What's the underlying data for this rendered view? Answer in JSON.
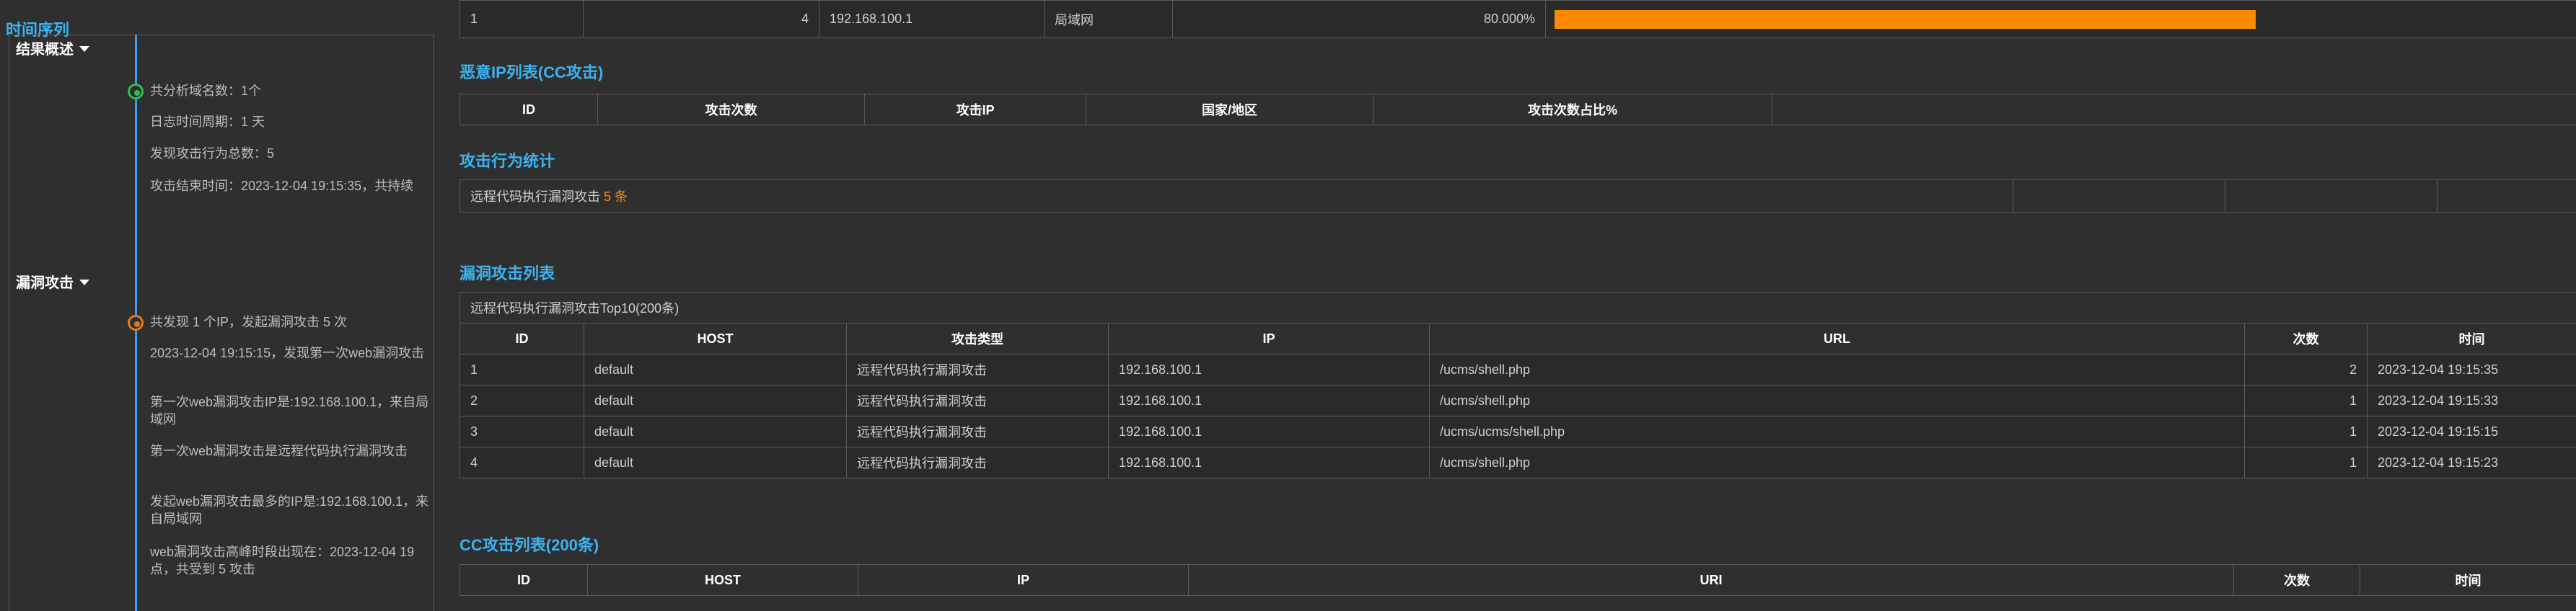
{
  "sidebar": {
    "title": "时间序列",
    "sections": [
      {
        "heading": "结果概述",
        "events": [
          "共分析域名数：1个",
          "日志时间周期：1 天",
          "发现攻击行为总数：5",
          "攻击结束时间：2023-12-04 19:15:35，共持续"
        ]
      },
      {
        "heading": "漏洞攻击",
        "events": [
          "共发现 1 个IP，发起漏洞攻击 5 次",
          "2023-12-04 19:15:15，发现第一次web漏洞攻击",
          "第一次web漏洞攻击IP是:192.168.100.1，来自局域网",
          "第一次web漏洞攻击是远程代码执行漏洞攻击",
          "发起web漏洞攻击最多的IP是:192.168.100.1，来自局域网",
          "web漏洞攻击高峰时段出现在：2023-12-04 19点，共受到 5 攻击"
        ]
      }
    ]
  },
  "top_row": {
    "id": "1",
    "count": "4",
    "ip": "192.168.100.1",
    "region": "局域网",
    "percent": "80.000%",
    "percent_value": 80
  },
  "cc_ip_list": {
    "title": "恶意IP列表(CC攻击)",
    "columns": [
      "ID",
      "攻击次数",
      "攻击IP",
      "国家/地区",
      "攻击次数占比%",
      ""
    ]
  },
  "attack_stats": {
    "title": "攻击行为统计",
    "row_label": "远程代码执行漏洞攻击",
    "row_count": "5 条"
  },
  "vuln_list": {
    "title": "漏洞攻击列表",
    "caption": "远程代码执行漏洞攻击Top10(200条)",
    "columns": [
      "ID",
      "HOST",
      "攻击类型",
      "IP",
      "URL",
      "次数",
      "时间"
    ],
    "rows": [
      [
        "1",
        "default",
        "远程代码执行漏洞攻击",
        "192.168.100.1",
        "/ucms/shell.php",
        "2",
        "2023-12-04 19:15:35"
      ],
      [
        "2",
        "default",
        "远程代码执行漏洞攻击",
        "192.168.100.1",
        "/ucms/shell.php",
        "1",
        "2023-12-04 19:15:33"
      ],
      [
        "3",
        "default",
        "远程代码执行漏洞攻击",
        "192.168.100.1",
        "/ucms/ucms/shell.php",
        "1",
        "2023-12-04 19:15:15"
      ],
      [
        "4",
        "default",
        "远程代码执行漏洞攻击",
        "192.168.100.1",
        "/ucms/shell.php",
        "1",
        "2023-12-04 19:15:23"
      ]
    ]
  },
  "cc_list": {
    "title": "CC攻击列表(200条)",
    "columns": [
      "ID",
      "HOST",
      "IP",
      "URI",
      "次数",
      "时间"
    ]
  },
  "colors": {
    "accent": "#3cb3f0",
    "bar": "#ff8a00",
    "green_dot": "#2fbf4f",
    "orange_dot": "#e07a22",
    "lan": "#f0e000"
  }
}
